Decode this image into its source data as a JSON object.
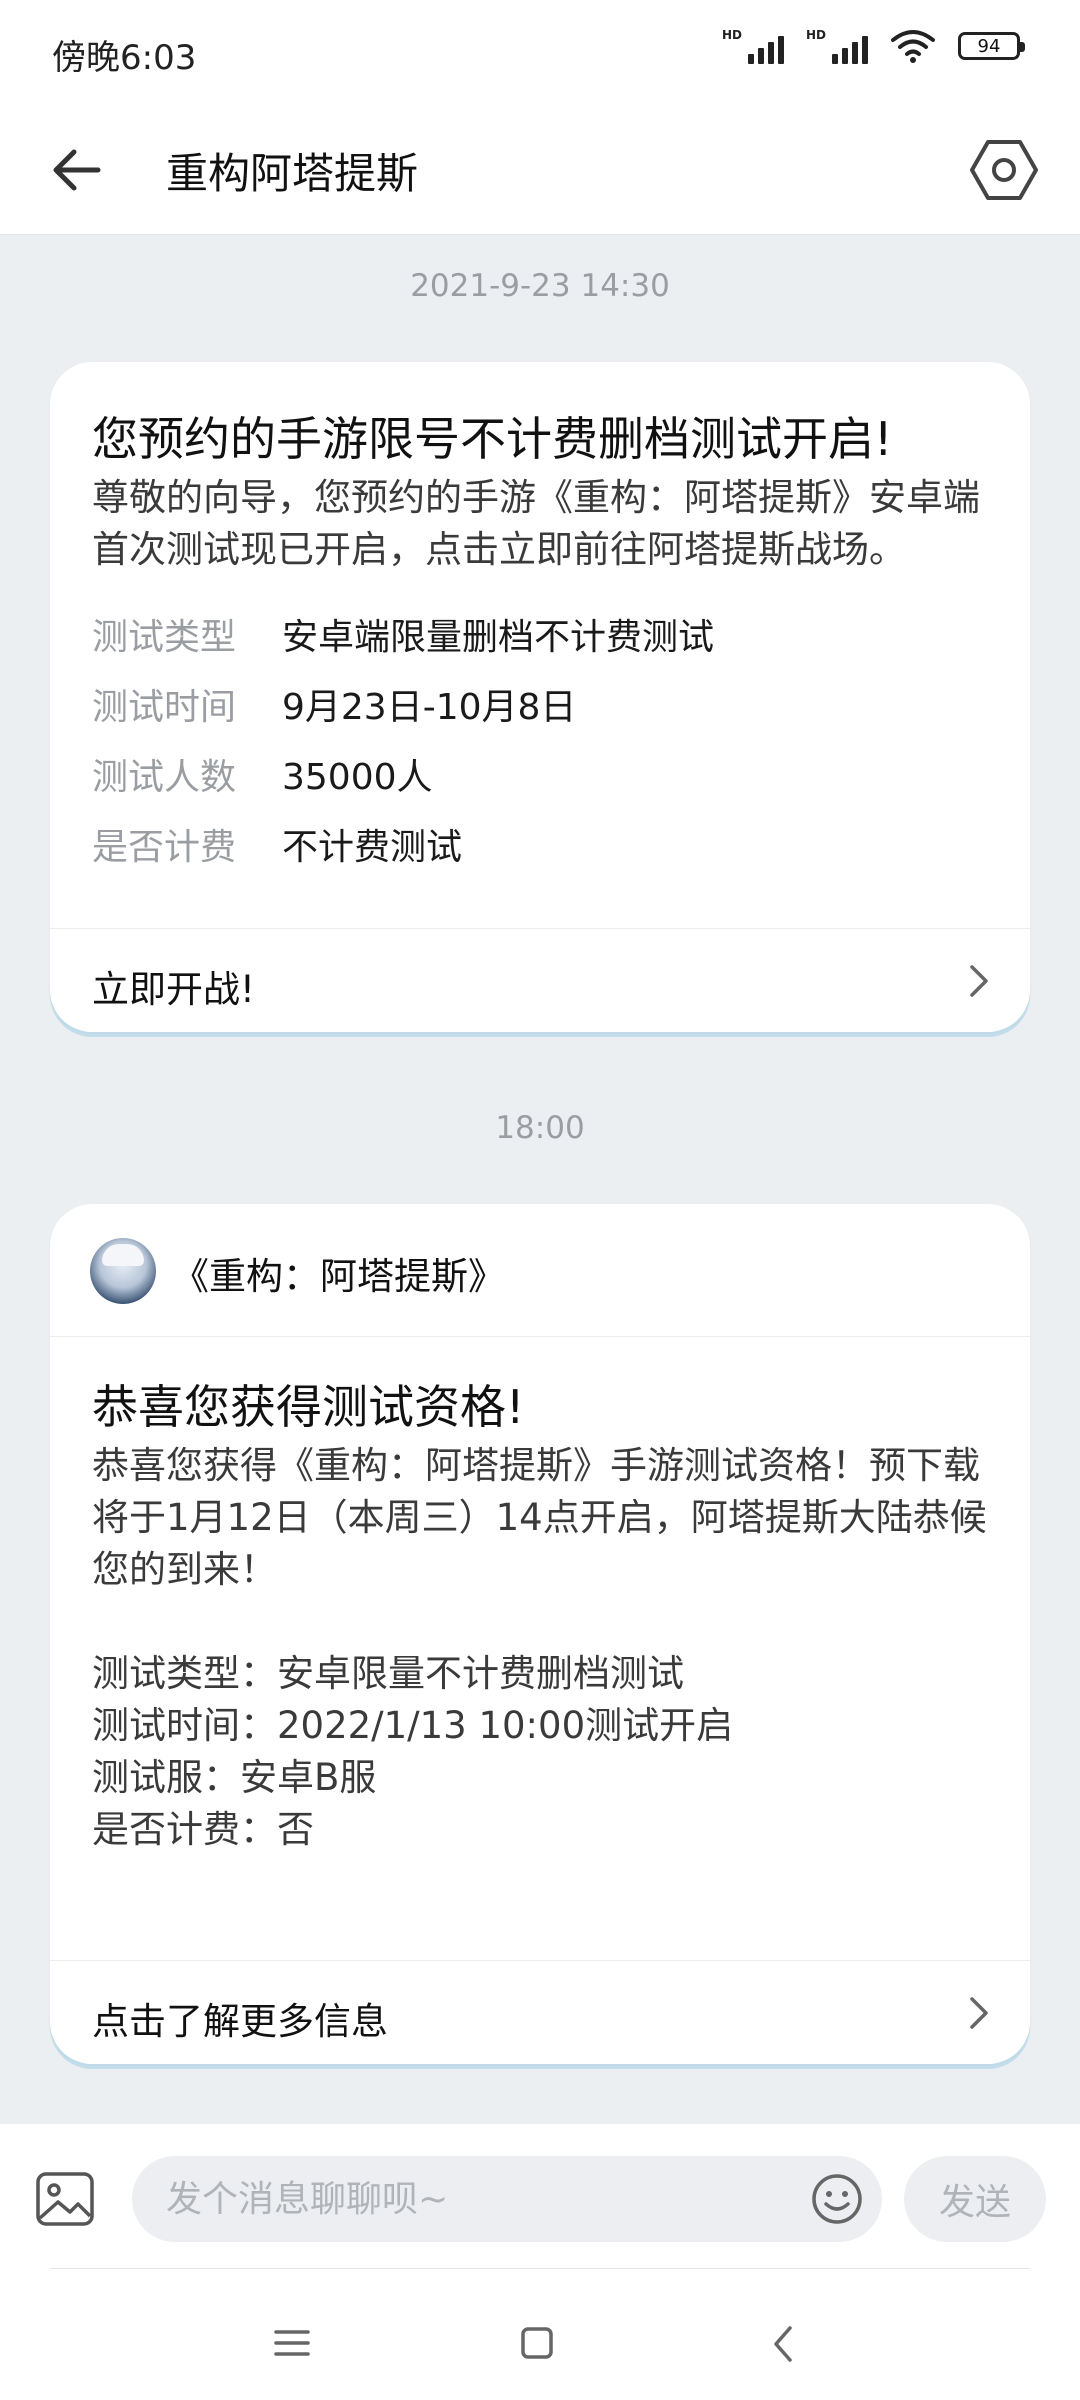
{
  "status_bar": {
    "time": "傍晚6:03",
    "battery": "94",
    "signal_label_1": "HD",
    "signal_label_2": "HD"
  },
  "header": {
    "title": "重构阿塔提斯",
    "back_icon": "arrow-left-icon",
    "settings_icon": "hexagon-settings-icon"
  },
  "messages": [
    {
      "timestamp": "2021-9-23 14:30",
      "title": "您预约的手游限号不计费删档测试开启!",
      "body": "尊敬的向导，您预约的手游《重构：阿塔提斯》安卓端首次测试现已开启，点击立即前往阿塔提斯战场。",
      "details": [
        {
          "label": "测试类型",
          "value": "安卓端限量删档不计费测试"
        },
        {
          "label": "测试时间",
          "value": "9月23日-10月8日"
        },
        {
          "label": "测试人数",
          "value": "35000人"
        },
        {
          "label": "是否计费",
          "value": "不计费测试"
        }
      ],
      "action": "立即开战!"
    },
    {
      "timestamp": "18:00",
      "sender": "《重构：阿塔提斯》",
      "title": "恭喜您获得测试资格!",
      "body": "恭喜您获得《重构：阿塔提斯》手游测试资格！预下载将于1月12日（本周三）14点开启，阿塔提斯大陆恭候您的到来！",
      "lines": [
        "测试类型：安卓限量不计费删档测试",
        "测试时间：2022/1/13 10:00测试开启",
        "测试服：安卓B服",
        "是否计费：否"
      ],
      "action": "点击了解更多信息"
    }
  ],
  "input_bar": {
    "placeholder": "发个消息聊聊呗~",
    "send_label": "发送",
    "image_icon": "image-icon",
    "emoji_icon": "emoji-icon"
  },
  "nav_bar": {
    "menu_icon": "menu-icon",
    "home_icon": "home-square-icon",
    "back_icon": "back-chevron-icon"
  }
}
